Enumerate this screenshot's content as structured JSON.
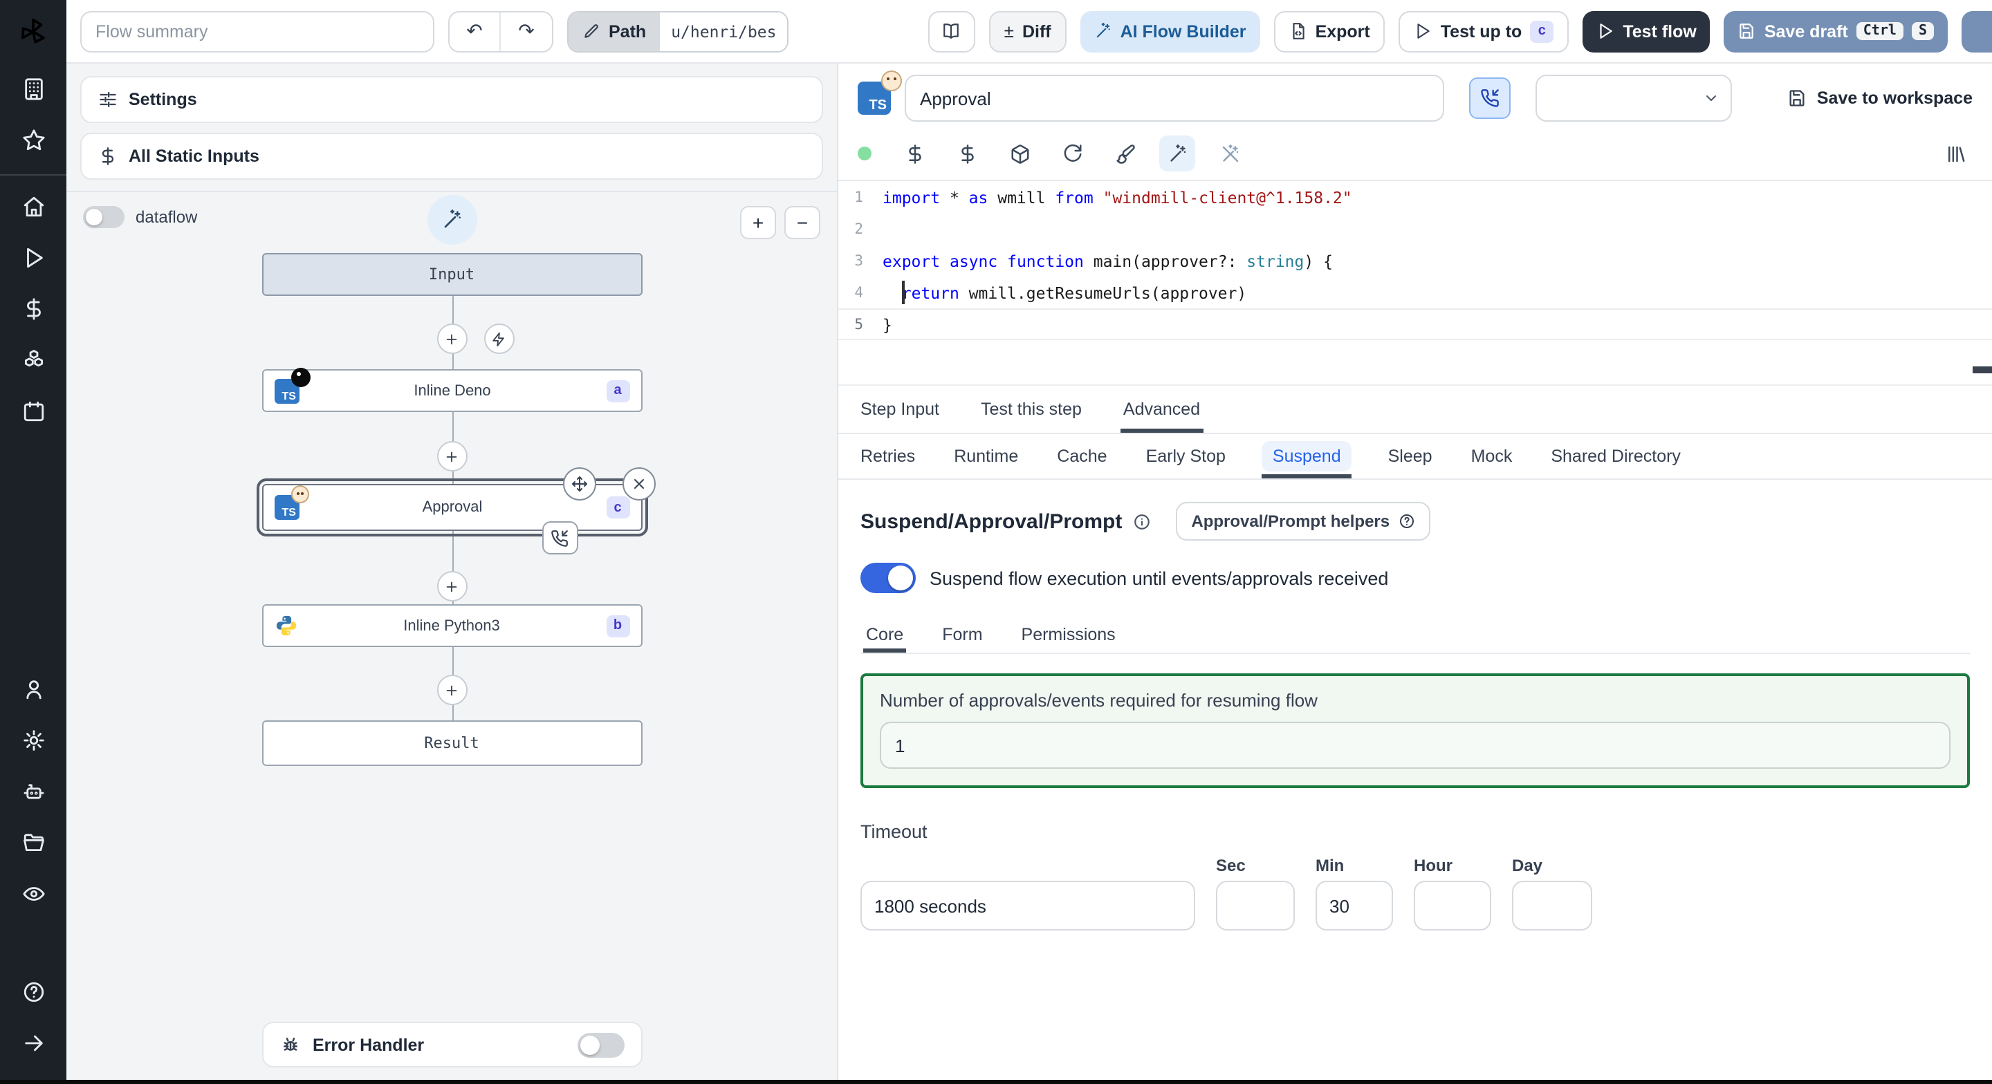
{
  "colors": {
    "accent_blue": "#2563eb",
    "toggle_blue": "#3566e0",
    "save_draft_blue": "#7590b4",
    "dark_button": "#2b323f",
    "badge_bg": "#dfe3fb",
    "badge_text": "#4338ca",
    "green_border": "#1b7a3f",
    "sidebar_dark": "#1c2127",
    "ai_button_bg": "#d9e9f9",
    "status_dot_green": "#86dfa0",
    "ts_chip_blue": "#3178c6"
  },
  "topbar": {
    "flow_summary_placeholder": "Flow summary",
    "undo_icon": "↶",
    "redo_icon": "↷",
    "path_label": "Path",
    "path_value": "u/henri/bes",
    "diff_icon": "±",
    "diff_label": "Diff",
    "ai_flow_builder_label": "AI Flow Builder",
    "export_label": "Export",
    "test_up_to_label": "Test up to",
    "test_up_to_badge": "c",
    "test_flow_label": "Test flow",
    "save_draft_label": "Save draft",
    "save_draft_keys": [
      "Ctrl",
      "S"
    ]
  },
  "flow_panel": {
    "settings_label": "Settings",
    "static_inputs_label": "All Static Inputs",
    "dataflow_label": "dataflow",
    "zoom_in": "+",
    "zoom_out": "−",
    "nodes": {
      "input": {
        "label": "Input"
      },
      "deno": {
        "label": "Inline Deno",
        "badge": "a",
        "lang": "TS"
      },
      "approval": {
        "label": "Approval",
        "badge": "c",
        "lang": "TS"
      },
      "python": {
        "label": "Inline Python3",
        "badge": "b"
      },
      "result": {
        "label": "Result"
      }
    },
    "error_handler_label": "Error Handler"
  },
  "step_panel": {
    "lang_chip": "TS",
    "title_value": "Approval",
    "save_to_workspace_label": "Save to workspace",
    "code": {
      "current_line": 5,
      "lines": [
        [
          [
            "kw",
            "import"
          ],
          [
            "pl",
            " * "
          ],
          [
            "kw",
            "as"
          ],
          [
            "pl",
            " wmill "
          ],
          [
            "kw",
            "from"
          ],
          [
            "pl",
            " "
          ],
          [
            "str",
            "\"windmill-client@^1.158.2\""
          ]
        ],
        [],
        [
          [
            "kw",
            "export"
          ],
          [
            "pl",
            " "
          ],
          [
            "kw",
            "async"
          ],
          [
            "pl",
            " "
          ],
          [
            "kw",
            "function"
          ],
          [
            "pl",
            " main(approver?: "
          ],
          [
            "typ",
            "string"
          ],
          [
            "pl",
            ") {"
          ]
        ],
        [
          [
            "pl",
            "  "
          ],
          [
            "kw",
            "return"
          ],
          [
            "pl",
            " wmill.getResumeUrls(approver)"
          ]
        ],
        [
          [
            "pl",
            "}"
          ]
        ]
      ]
    },
    "tabs": [
      "Step Input",
      "Test this step",
      "Advanced"
    ],
    "active_tab": "Advanced",
    "subtabs": [
      "Retries",
      "Runtime",
      "Cache",
      "Early Stop",
      "Suspend",
      "Sleep",
      "Mock",
      "Shared Directory"
    ],
    "active_subtab": "Suspend",
    "suspend": {
      "heading": "Suspend/Approval/Prompt",
      "helpers_label": "Approval/Prompt helpers",
      "toggle_label": "Suspend flow execution until events/approvals received",
      "toggle_on": true,
      "tabs": [
        "Core",
        "Form",
        "Permissions"
      ],
      "active_tab": "Core",
      "approvals_label": "Number of approvals/events required for resuming flow",
      "approvals_value": "1",
      "timeout_label": "Timeout",
      "timeout_value": "1800 seconds",
      "units": [
        {
          "label": "Sec",
          "value": ""
        },
        {
          "label": "Min",
          "value": "30"
        },
        {
          "label": "Hour",
          "value": ""
        },
        {
          "label": "Day",
          "value": ""
        }
      ]
    }
  }
}
